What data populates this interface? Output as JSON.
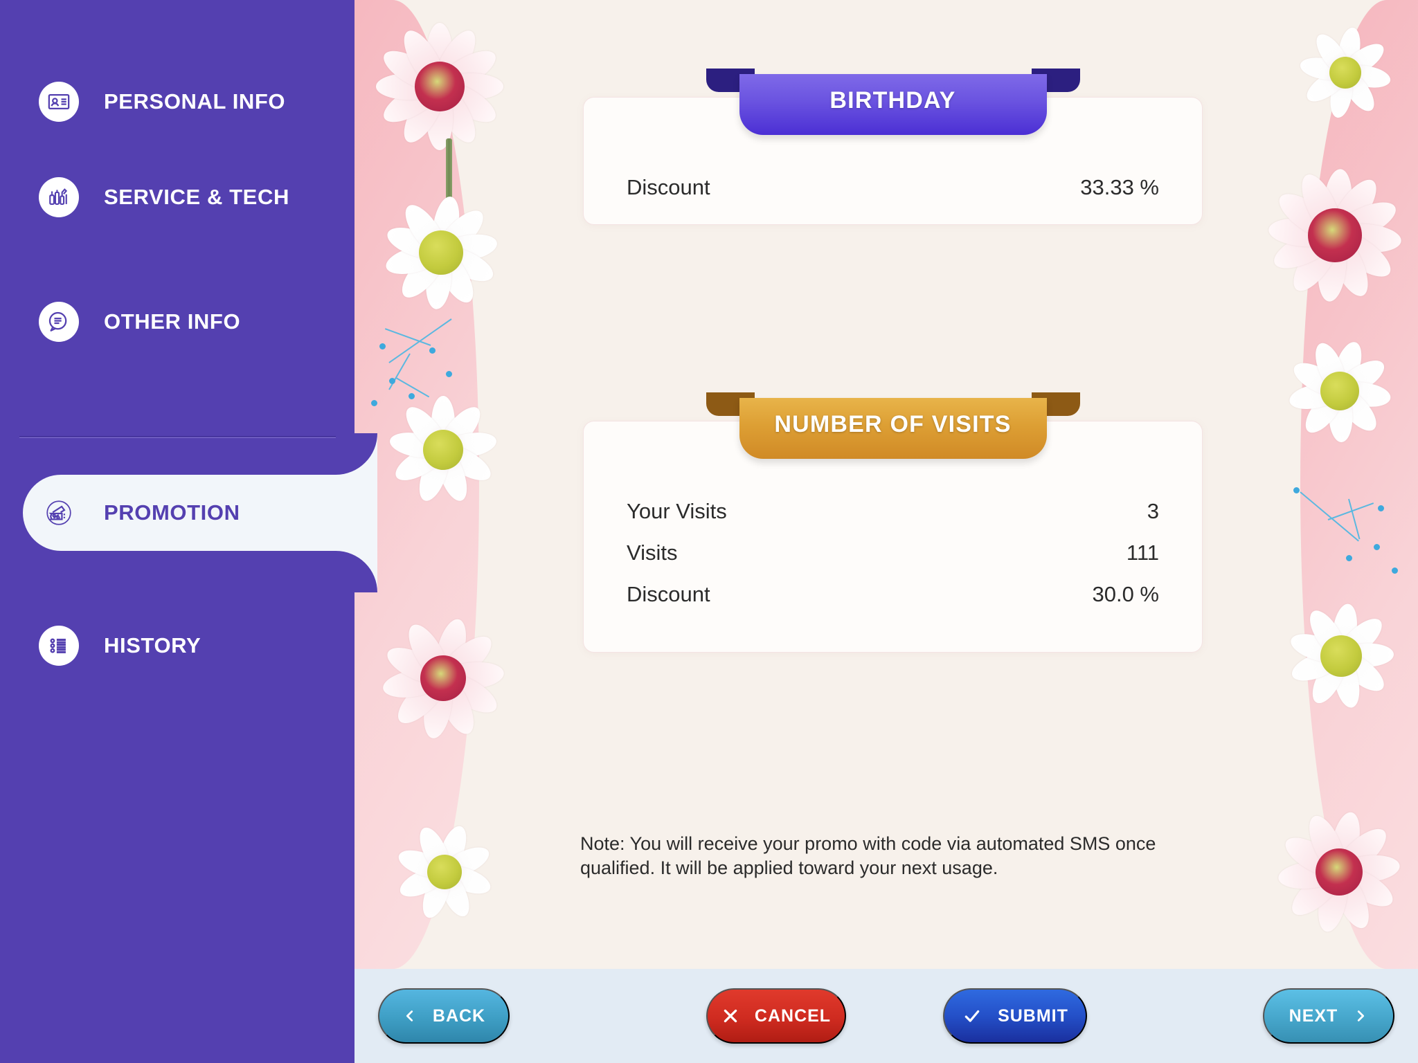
{
  "sidebar": {
    "items": [
      {
        "label": "PERSONAL INFO",
        "icon": "id-card-icon",
        "active": false
      },
      {
        "label": "SERVICE & TECH",
        "icon": "cosmetics-icon",
        "active": false
      },
      {
        "label": "OTHER INFO",
        "icon": "chat-info-icon",
        "active": false
      },
      {
        "label": "PROMOTION",
        "icon": "discount-ticket-icon",
        "active": true
      },
      {
        "label": "HISTORY",
        "icon": "list-history-icon",
        "active": false
      }
    ],
    "background_color": "#5440b0",
    "active_pill_color": "#f2f6fa",
    "active_text_color": "#5440b0"
  },
  "main": {
    "cards": [
      {
        "title": "BIRTHDAY",
        "accent_color": "#5438d6",
        "rows": [
          {
            "key": "Discount",
            "value": "33.33 %"
          }
        ]
      },
      {
        "title": "NUMBER OF VISITS",
        "accent_color": "#d89a2e",
        "rows": [
          {
            "key": "Your Visits",
            "value": "3"
          },
          {
            "key": "Visits",
            "value": "111"
          },
          {
            "key": "Discount",
            "value": "30.0 %"
          }
        ]
      }
    ],
    "note": "Note: You will receive your promo with code via automated SMS once qualified. It will be applied toward your next usage."
  },
  "footer": {
    "background_color": "#e2ebf4",
    "buttons": [
      {
        "label": "BACK",
        "icon": "chevron-left-icon",
        "color": "#3e9ec4"
      },
      {
        "label": "CANCEL",
        "icon": "close-x-icon",
        "color": "#cf2b20"
      },
      {
        "label": "SUBMIT",
        "icon": "check-icon",
        "color": "#2450c8"
      },
      {
        "label": "NEXT",
        "icon": "chevron-right-icon",
        "color": "#46a6cb"
      }
    ]
  }
}
